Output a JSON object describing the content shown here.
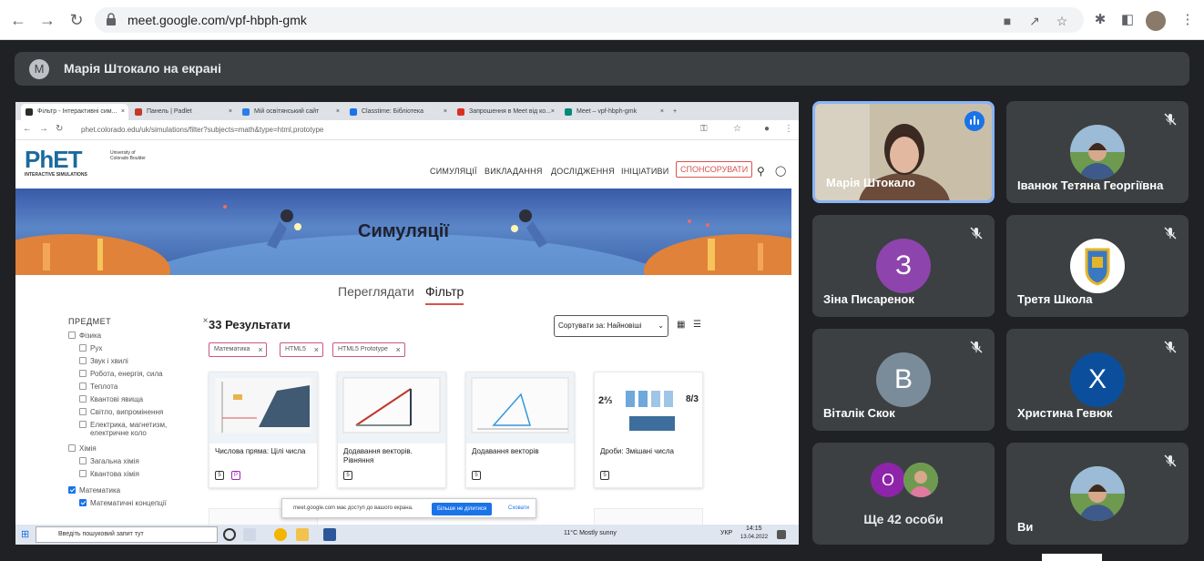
{
  "browser": {
    "url": "meet.google.com/vpf-hbph-gmk"
  },
  "banner": {
    "avatar_letter": "M",
    "text": "Марія Штокало на екрані"
  },
  "shared_screen": {
    "tabs": [
      {
        "label": "Фільтр - Інтерактивні сим...",
        "color": "#2b2b2b",
        "active": true
      },
      {
        "label": "Панель | Padlet",
        "color": "#c0392b"
      },
      {
        "label": "Мій освітянський сайт",
        "color": "#2b7de9"
      },
      {
        "label": "Classtime: Бібліотека",
        "color": "#1a73e8"
      },
      {
        "label": "Запрошення в Meet від ко...",
        "color": "#d93025"
      },
      {
        "label": "Meet – vpf-hbph-gmk",
        "color": "#00897b"
      }
    ],
    "address": "phet.colorado.edu/uk/simulations/filter?subjects=math&type=html,prototype",
    "logo": {
      "big": "PhET",
      "small": "INTERACTIVE SIMULATIONS"
    },
    "university": "University of Colorado Boulder",
    "menu": [
      "СИМУЛЯЦІЇ",
      "ВИКЛАДАННЯ",
      "ДОСЛІДЖЕННЯ",
      "ІНІЦІАТИВИ"
    ],
    "sponsor": "СПОНСОРУВАТИ",
    "hero_title": "Симуляції",
    "subtabs": {
      "browse": "Переглядати",
      "filter": "Фільтр"
    },
    "sidebar": {
      "title": "ПРЕДМЕТ",
      "items": [
        {
          "label": "Фізика",
          "level": 1,
          "checked": false
        },
        {
          "label": "Рух",
          "level": 2,
          "checked": false
        },
        {
          "label": "Звук і хвилі",
          "level": 2,
          "checked": false
        },
        {
          "label": "Робота, енергія, сила",
          "level": 2,
          "checked": false
        },
        {
          "label": "Теплота",
          "level": 2,
          "checked": false
        },
        {
          "label": "Квантові явища",
          "level": 2,
          "checked": false
        },
        {
          "label": "Світло, випромінення",
          "level": 2,
          "checked": false
        },
        {
          "label": "Електрика, магнетизм, електричне коло",
          "level": 2,
          "checked": false
        },
        {
          "label": "Хімія",
          "level": 1,
          "checked": false
        },
        {
          "label": "Загальна хімія",
          "level": 2,
          "checked": false
        },
        {
          "label": "Квантова хімія",
          "level": 2,
          "checked": false
        },
        {
          "label": "Математика",
          "level": 1,
          "checked": true
        },
        {
          "label": "Математичні концепції",
          "level": 2,
          "checked": true
        }
      ]
    },
    "results_label": "33 Результати",
    "sort_label": "Сортувати за: Найновіші",
    "chips": [
      "Математика",
      "HTML5",
      "HTML5 Prototype"
    ],
    "cards": [
      {
        "title": "Числова пряма: Цілі числа"
      },
      {
        "title": "Додавання векторів. Рівняння"
      },
      {
        "title": "Додавання векторів"
      },
      {
        "title": "Дроби: Змішані числа"
      }
    ],
    "share_note": {
      "text": "meet.google.com має доступ до вашого екрана.",
      "stop": "Більше не ділитися",
      "hide": "Сховати"
    },
    "taskbar": {
      "search": "Введіть пошуковий запит тут",
      "weather": "11°C  Mostly sunny",
      "lang": "УКР",
      "time": "14:15",
      "date": "13.04.2022"
    }
  },
  "participants": [
    {
      "name": "Марія Штокало",
      "speaking": true
    },
    {
      "name": "Іванюк Тетяна Георгіївна"
    },
    {
      "name": "Зіна Писаренок",
      "letter": "З",
      "color": "#8e44ad"
    },
    {
      "name": "Третя Школа"
    },
    {
      "name": "Віталік Скок",
      "letter": "В",
      "color": "#7a8c99"
    },
    {
      "name": "Христина Гевюк",
      "letter": "Х",
      "color": "#0b4f9c"
    },
    {
      "name": "Ще 42 особи",
      "letter": "О",
      "color": "#8e24aa"
    },
    {
      "name": "Ви"
    }
  ]
}
